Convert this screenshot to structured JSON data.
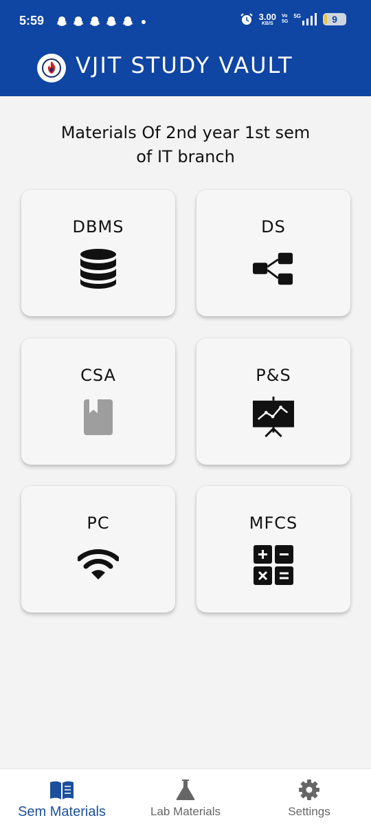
{
  "status_bar": {
    "time": "5:59",
    "net_speed_value": "3.00",
    "net_speed_unit": "KB/S",
    "volte_top": "Vo",
    "volte_bottom": "5G",
    "network": "5G",
    "battery": "9",
    "notification_icons": [
      "snapchat-icon",
      "snapchat-icon",
      "snapchat-icon",
      "snapchat-icon",
      "snapchat-icon"
    ]
  },
  "app_bar": {
    "title": "VJIT STUDY VAULT",
    "logo": "vjit-flame-logo"
  },
  "heading": {
    "line1": "Materials Of 2nd year 1st sem",
    "line2": "of IT branch"
  },
  "subjects": [
    {
      "label": "DBMS",
      "icon": "database-icon"
    },
    {
      "label": "DS",
      "icon": "share-nodes-icon"
    },
    {
      "label": "CSA",
      "icon": "book-icon"
    },
    {
      "label": "P&S",
      "icon": "chart-presentation-icon"
    },
    {
      "label": "PC",
      "icon": "wifi-icon"
    },
    {
      "label": "MFCS",
      "icon": "calculator-icon"
    }
  ],
  "bottom_nav": {
    "items": [
      {
        "label": "Sem Materials",
        "icon": "open-book-icon",
        "active": true
      },
      {
        "label": "Lab Materials",
        "icon": "flask-icon",
        "active": false
      },
      {
        "label": "Settings",
        "icon": "gear-icon",
        "active": false
      }
    ]
  },
  "colors": {
    "primary": "#0f45a3",
    "background": "#f3f3f3",
    "active_nav": "#1c4f9c",
    "inactive_nav": "#666666"
  }
}
